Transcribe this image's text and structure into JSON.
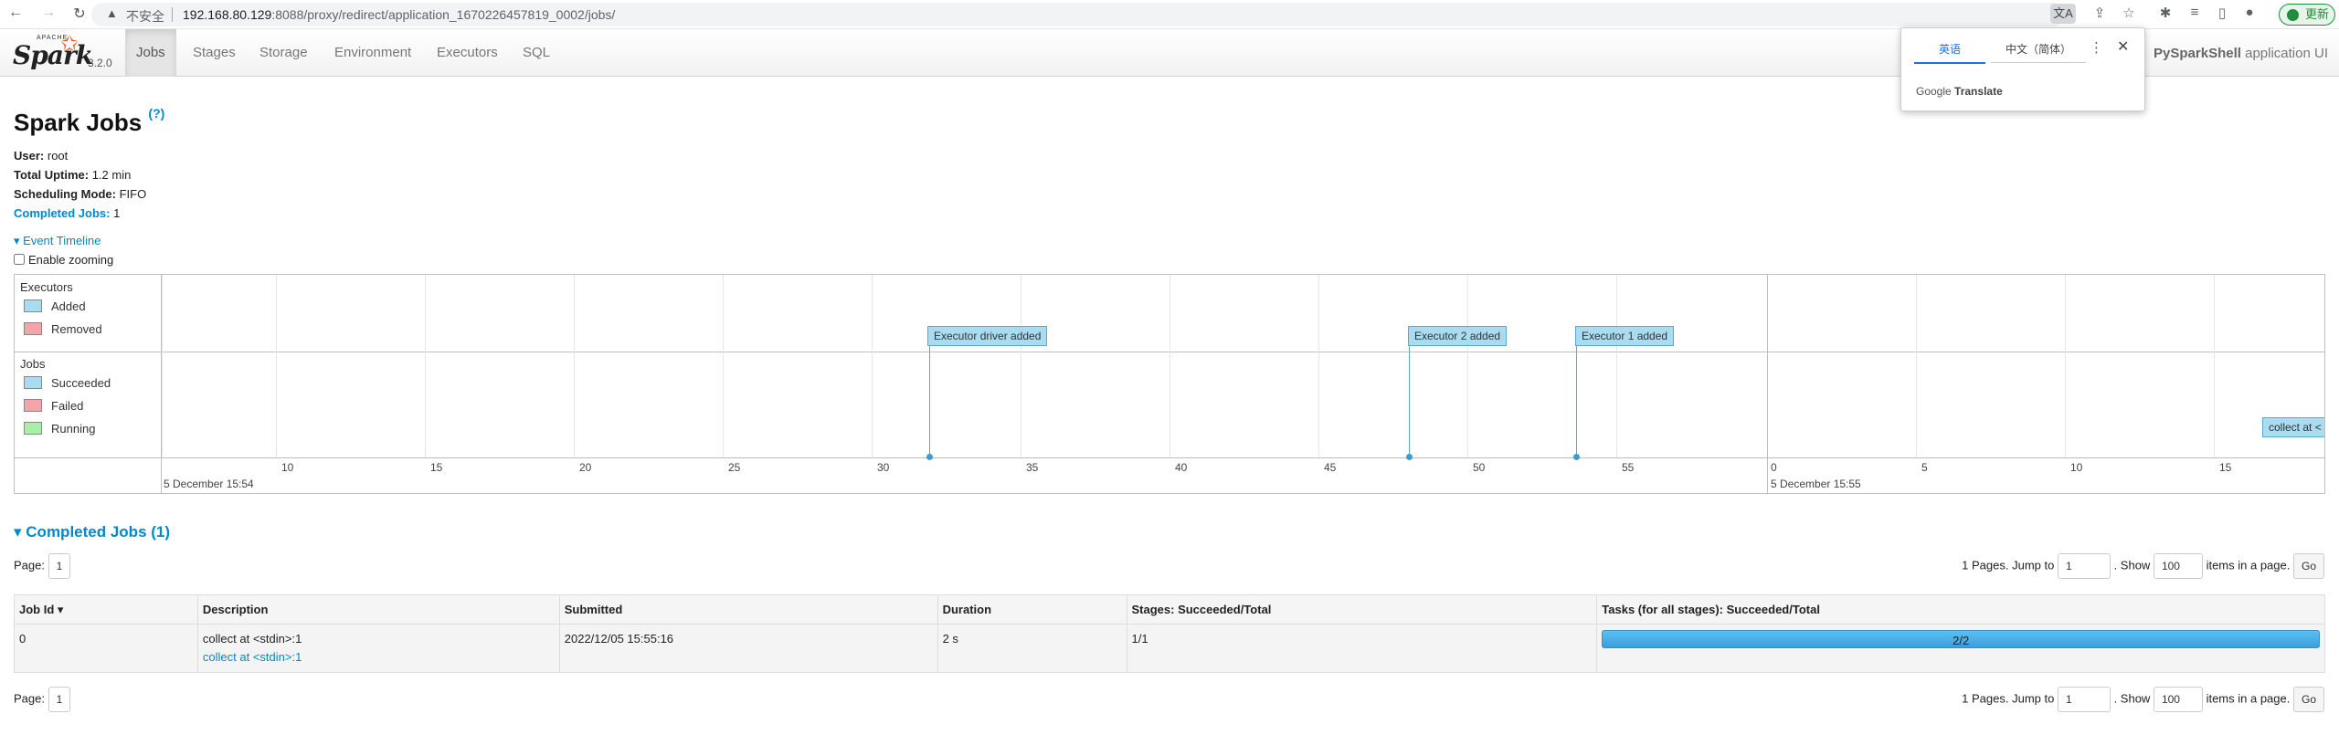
{
  "browser": {
    "insecure_label": "不安全",
    "url_host": "192.168.80.129",
    "url_rest": ":8088/proxy/redirect/application_1670226457819_0002/jobs/",
    "update_label": "更新"
  },
  "translate_popup": {
    "lang_en": "英语",
    "lang_zh": "中文（简体）",
    "brand": "Google",
    "brand_suffix": "Translate"
  },
  "navbar": {
    "brand_top": "APACHE",
    "brand_word": "Spark",
    "version": "3.2.0",
    "tabs": [
      "Jobs",
      "Stages",
      "Storage",
      "Environment",
      "Executors",
      "SQL"
    ],
    "active_tab": "Jobs",
    "app_name": "PySparkShell",
    "app_suffix": "application UI"
  },
  "page": {
    "title": "Spark Jobs",
    "help": "(?)",
    "user_label": "User:",
    "user": "root",
    "uptime_label": "Total Uptime:",
    "uptime": "1.2 min",
    "mode_label": "Scheduling Mode:",
    "mode": "FIFO",
    "completed_label": "Completed Jobs:",
    "completed": "1",
    "timeline_toggle": "Event Timeline",
    "enable_zoom": "Enable zooming"
  },
  "timeline": {
    "executors_label": "Executors",
    "legend_added": "Added",
    "legend_removed": "Removed",
    "jobs_label": "Jobs",
    "legend_succeeded": "Succeeded",
    "legend_failed": "Failed",
    "legend_running": "Running",
    "ticks": [
      "10",
      "15",
      "20",
      "25",
      "30",
      "35",
      "40",
      "45",
      "50",
      "55",
      "0",
      "5",
      "10",
      "15"
    ],
    "date_left": "5 December 15:54",
    "date_right": "5 December 15:55",
    "events": [
      "Executor driver added",
      "Executor 2 added",
      "Executor 1 added"
    ],
    "job_event": "collect at <",
    "colors": {
      "added": "#a9dcf1",
      "removed": "#f4a4a8",
      "running": "#a8f0a8"
    }
  },
  "completed_jobs": {
    "title": "Completed Jobs (1)",
    "page_label": "Page:",
    "page_value": "1",
    "pages_text": "1 Pages. Jump to",
    "jump_value": "1",
    "show_text": ". Show",
    "show_value": "100",
    "items_text": "items in a page.",
    "go_label": "Go",
    "columns": [
      "Job Id ▾",
      "Description",
      "Submitted",
      "Duration",
      "Stages: Succeeded/Total",
      "Tasks (for all stages): Succeeded/Total"
    ],
    "rows": [
      {
        "job_id": "0",
        "desc": "collect at <stdin>:1",
        "desc_link": "collect at <stdin>:1",
        "submitted": "2022/12/05 15:55:16",
        "duration": "2 s",
        "stages": "1/1",
        "tasks": "2/2",
        "tasks_progress": 1.0
      }
    ]
  }
}
